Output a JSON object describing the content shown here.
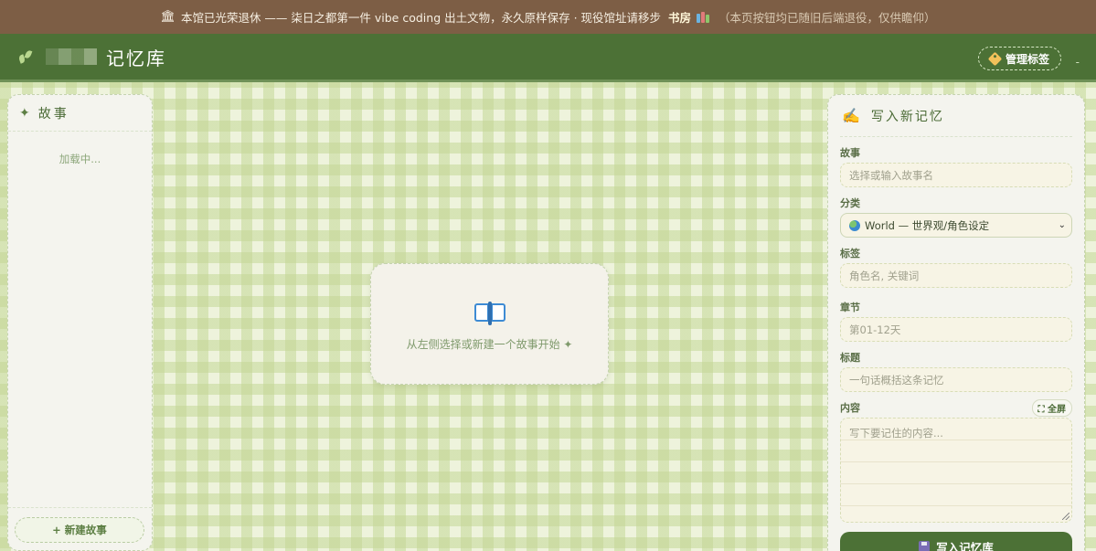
{
  "banner": {
    "icon": "museum-icon",
    "text": "本馆已光荣退休 —— 柒日之都第一件 vibe coding 出土文物，永久原样保存 · 现役馆址请移步",
    "link_label": "书房",
    "link_icon": "books-icon",
    "note": "（本页按钮均已随旧后端退役，仅供瞻仰）"
  },
  "header": {
    "title": "记忆库",
    "logo_icon": "leaf-icon",
    "manage_tags_label": "管理标签",
    "trailing_text": "-"
  },
  "left_panel": {
    "title": "故事",
    "loading_text": "加载中...",
    "new_story_label": "+ 新建故事"
  },
  "center": {
    "empty_icon": "open-book-icon",
    "empty_text": "从左侧选择或新建一个故事开始 ✦"
  },
  "form": {
    "title": "写入新记忆",
    "story": {
      "label": "故事",
      "placeholder": "选择或输入故事名"
    },
    "category": {
      "label": "分类",
      "selected": "World — 世界观/角色设定"
    },
    "tags": {
      "label": "标签",
      "placeholder": "角色名, 关键词"
    },
    "chapter": {
      "label": "章节",
      "placeholder": "第01-12天"
    },
    "heading": {
      "label": "标题",
      "placeholder": "一句话概括这条记忆"
    },
    "content": {
      "label": "内容",
      "fullscreen_label": "⛶ 全屏",
      "placeholder": "写下要记住的内容..."
    },
    "submit_label": "写入记忆库"
  },
  "colors": {
    "banner_bg": "#7d5e45",
    "header_bg": "#4c7136",
    "accent": "#4c7136",
    "panel_bg": "#f4f4ee",
    "checker_light": "#eef3dc",
    "checker_dark": "#c4d696"
  }
}
